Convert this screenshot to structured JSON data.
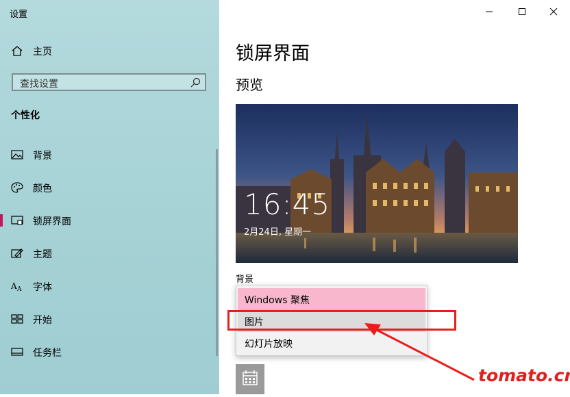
{
  "window": {
    "title": "设置"
  },
  "sidebar": {
    "home": "主页",
    "search_placeholder": "查找设置",
    "section": "个性化",
    "items": [
      {
        "label": "背景",
        "icon": "image-icon"
      },
      {
        "label": "颜色",
        "icon": "palette-icon"
      },
      {
        "label": "锁屏界面",
        "icon": "lock-screen-icon",
        "active": true
      },
      {
        "label": "主题",
        "icon": "theme-icon"
      },
      {
        "label": "字体",
        "icon": "font-icon"
      },
      {
        "label": "开始",
        "icon": "start-icon"
      },
      {
        "label": "任务栏",
        "icon": "taskbar-icon"
      }
    ]
  },
  "main": {
    "title": "锁屏界面",
    "preview_heading": "预览",
    "preview": {
      "time": "16:45",
      "date": "2月24日, 星期一"
    },
    "background_label": "背景",
    "dropdown_options": [
      "Windows 聚焦",
      "图片",
      "幻灯片放映"
    ],
    "selected_option": "Windows 聚焦",
    "hovered_option": "图片"
  },
  "watermark": "tomato.cm",
  "colors": {
    "accent": "#c2185b",
    "selection": "#f8b7cc",
    "annotation": "#ea1c1c"
  }
}
